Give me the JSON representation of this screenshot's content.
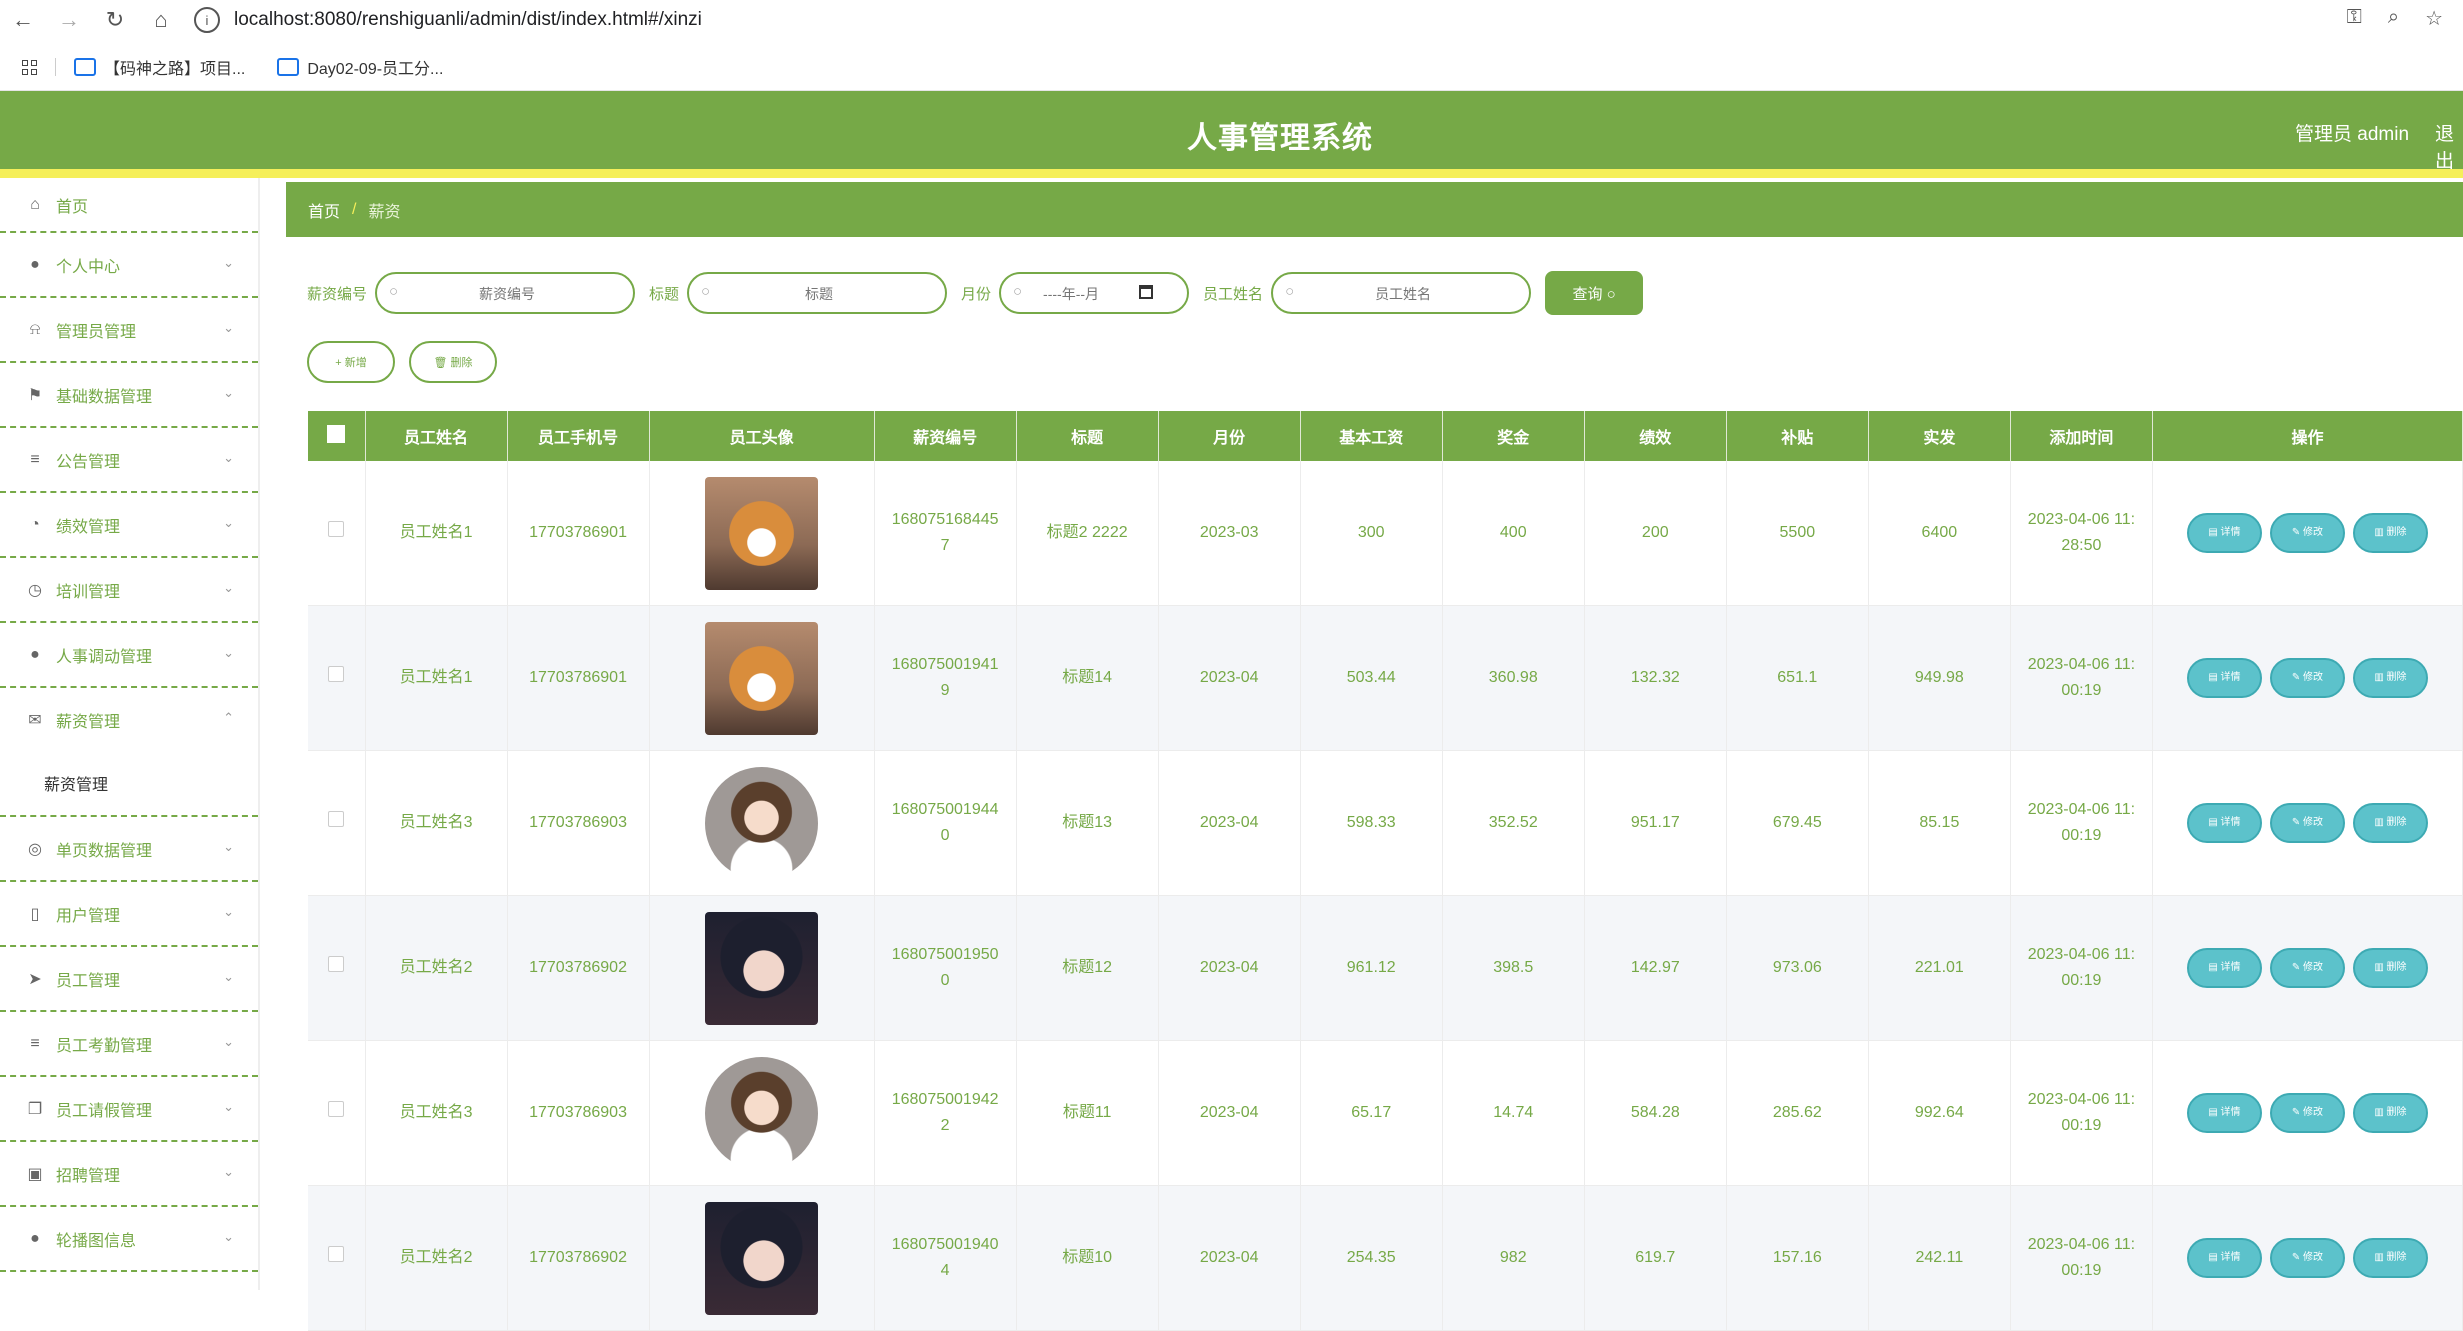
{
  "browser": {
    "url": "localhost:8080/renshiguanli/admin/dist/index.html#/xinzi",
    "bookmarks": [
      "【码神之路】项目...",
      "Day02-09-员工分..."
    ]
  },
  "header": {
    "title": "人事管理系统",
    "user": "管理员 admin",
    "logout": "退出"
  },
  "sidebar": {
    "items": [
      {
        "label": "首页",
        "icon": "home-icon"
      },
      {
        "label": "个人中心",
        "icon": "user-icon"
      },
      {
        "label": "管理员管理",
        "icon": "bell-icon"
      },
      {
        "label": "基础数据管理",
        "icon": "flag-icon"
      },
      {
        "label": "公告管理",
        "icon": "list-icon"
      },
      {
        "label": "绩效管理",
        "icon": "chart-icon"
      },
      {
        "label": "培训管理",
        "icon": "clock-icon"
      },
      {
        "label": "人事调动管理",
        "icon": "person-icon"
      },
      {
        "label": "薪资管理",
        "icon": "mail-icon"
      },
      {
        "label": "单页数据管理",
        "icon": "globe-icon"
      },
      {
        "label": "用户管理",
        "icon": "phone-icon"
      },
      {
        "label": "员工管理",
        "icon": "send-icon"
      },
      {
        "label": "员工考勤管理",
        "icon": "list-icon"
      },
      {
        "label": "员工请假管理",
        "icon": "copy-icon"
      },
      {
        "label": "招聘管理",
        "icon": "card-icon"
      },
      {
        "label": "轮播图信息",
        "icon": "person-icon"
      }
    ],
    "submenu": "薪资管理"
  },
  "breadcrumb": {
    "home": "首页",
    "sep": "/",
    "current": "薪资"
  },
  "search": {
    "fields": [
      {
        "label": "薪资编号",
        "placeholder": "薪资编号"
      },
      {
        "label": "标题",
        "placeholder": "标题"
      },
      {
        "label": "月份",
        "placeholder": "----年--月"
      },
      {
        "label": "员工姓名",
        "placeholder": "员工姓名"
      }
    ],
    "query": "查询"
  },
  "actions": {
    "add": "+ 新增",
    "delete": "删除"
  },
  "table": {
    "headers": [
      "员工姓名",
      "员工手机号",
      "员工头像",
      "薪资编号",
      "标题",
      "月份",
      "基本工资",
      "奖金",
      "绩效",
      "补贴",
      "实发",
      "添加时间",
      "操作"
    ],
    "op_labels": {
      "detail": "详情",
      "edit": "修改",
      "remove": "删除"
    },
    "rows": [
      {
        "name": "员工姓名1",
        "phone": "17703786901",
        "avatar": "dog",
        "no1": "168075168445",
        "no2": "7",
        "title": "标题2 2222",
        "month": "2023-03",
        "base": "300",
        "bonus": "400",
        "perf": "200",
        "allow": "5500",
        "net": "6400",
        "t1": "2023-04-06 11:",
        "t2": "28:50"
      },
      {
        "name": "员工姓名1",
        "phone": "17703786901",
        "avatar": "dog",
        "no1": "168075001941",
        "no2": "9",
        "title": "标题14",
        "month": "2023-04",
        "base": "503.44",
        "bonus": "360.98",
        "perf": "132.32",
        "allow": "651.1",
        "net": "949.98",
        "t1": "2023-04-06 11:",
        "t2": "00:19"
      },
      {
        "name": "员工姓名3",
        "phone": "17703786903",
        "avatar": "girl",
        "no1": "168075001944",
        "no2": "0",
        "title": "标题13",
        "month": "2023-04",
        "base": "598.33",
        "bonus": "352.52",
        "perf": "951.17",
        "allow": "679.45",
        "net": "85.15",
        "t1": "2023-04-06 11:",
        "t2": "00:19"
      },
      {
        "name": "员工姓名2",
        "phone": "17703786902",
        "avatar": "photo",
        "no1": "168075001950",
        "no2": "0",
        "title": "标题12",
        "month": "2023-04",
        "base": "961.12",
        "bonus": "398.5",
        "perf": "142.97",
        "allow": "973.06",
        "net": "221.01",
        "t1": "2023-04-06 11:",
        "t2": "00:19"
      },
      {
        "name": "员工姓名3",
        "phone": "17703786903",
        "avatar": "girl",
        "no1": "168075001942",
        "no2": "2",
        "title": "标题11",
        "month": "2023-04",
        "base": "65.17",
        "bonus": "14.74",
        "perf": "584.28",
        "allow": "285.62",
        "net": "992.64",
        "t1": "2023-04-06 11:",
        "t2": "00:19"
      },
      {
        "name": "员工姓名2",
        "phone": "17703786902",
        "avatar": "photo",
        "no1": "168075001940",
        "no2": "4",
        "title": "标题10",
        "month": "2023-04",
        "base": "254.35",
        "bonus": "982",
        "perf": "619.7",
        "allow": "157.16",
        "net": "242.11",
        "t1": "2023-04-06 11:",
        "t2": "00:19"
      }
    ]
  },
  "colors": {
    "primary": "#76a947",
    "accent": "#f5ef5a",
    "op_button": "#5cc2cb"
  }
}
